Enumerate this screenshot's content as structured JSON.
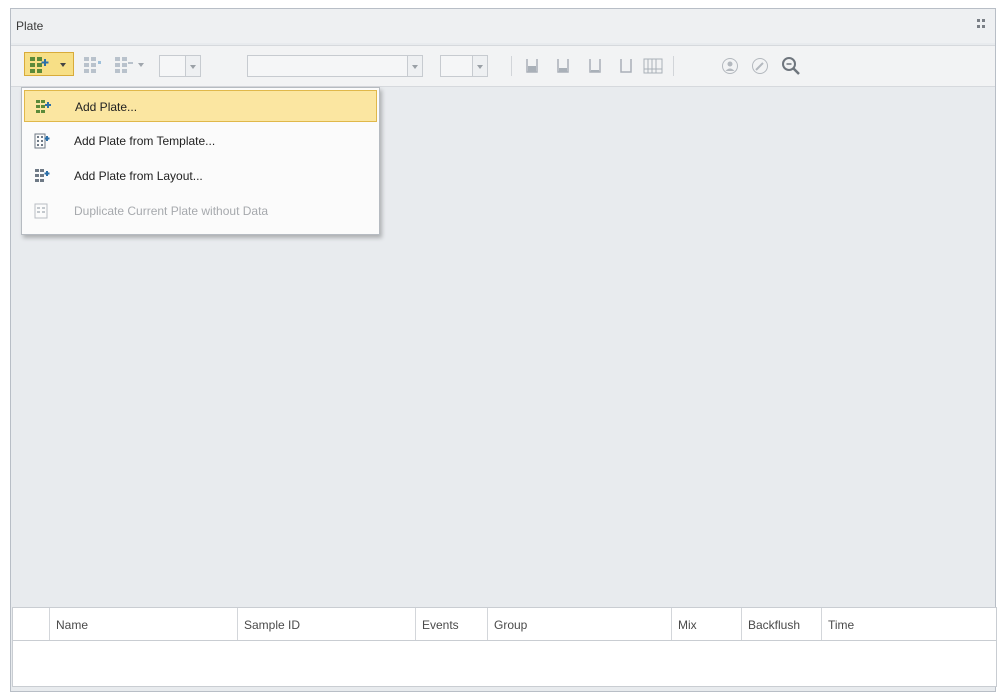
{
  "panel": {
    "title": "Plate"
  },
  "toolbar": {
    "add_plate_icon": "add-plate-icon",
    "combo_values": [
      "",
      "",
      ""
    ]
  },
  "menu": {
    "items": [
      {
        "label": "Add Plate...",
        "icon": "add-plate-icon",
        "highlighted": true,
        "enabled": true
      },
      {
        "label": "Add Plate from Template...",
        "icon": "plate-template-icon",
        "highlighted": false,
        "enabled": true
      },
      {
        "label": "Add Plate from Layout...",
        "icon": "plate-layout-icon",
        "highlighted": false,
        "enabled": true
      },
      {
        "label": "Duplicate Current Plate without Data",
        "icon": "duplicate-plate-icon",
        "highlighted": false,
        "enabled": false
      }
    ]
  },
  "table": {
    "columns": [
      "Name",
      "Sample ID",
      "Events",
      "Group",
      "Mix",
      "Backflush",
      "Time"
    ]
  },
  "colors": {
    "highlight": "#fbe6a1",
    "highlight_border": "#e0b84a",
    "panel_bg": "#e8ebee"
  }
}
